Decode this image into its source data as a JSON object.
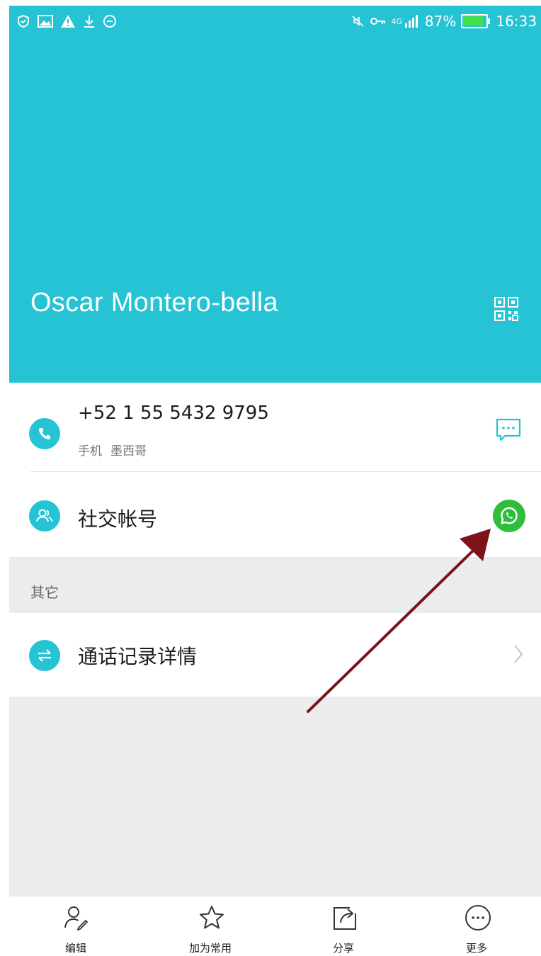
{
  "status_bar": {
    "battery_percent": "87%",
    "battery_level": 0.87,
    "network": "4G",
    "time": "16:33"
  },
  "contact": {
    "name": "Oscar Montero-bella"
  },
  "phone": {
    "number": "+52 1 55 5432 9795",
    "type": "手机",
    "location": "墨西哥"
  },
  "social": {
    "label": "社交帐号"
  },
  "other_section": {
    "title": "其它",
    "call_log_label": "通话记录详情"
  },
  "bottom_bar": {
    "tabs": [
      {
        "label": "编辑",
        "icon": "edit-contact-icon"
      },
      {
        "label": "加为常用",
        "icon": "star-icon"
      },
      {
        "label": "分享",
        "icon": "share-icon"
      },
      {
        "label": "更多",
        "icon": "more-icon"
      }
    ]
  },
  "colors": {
    "header": "#25c3d4",
    "accent": "#25c3d4",
    "whatsapp": "#2fbe3b",
    "annotation_arrow": "#7a1418"
  }
}
